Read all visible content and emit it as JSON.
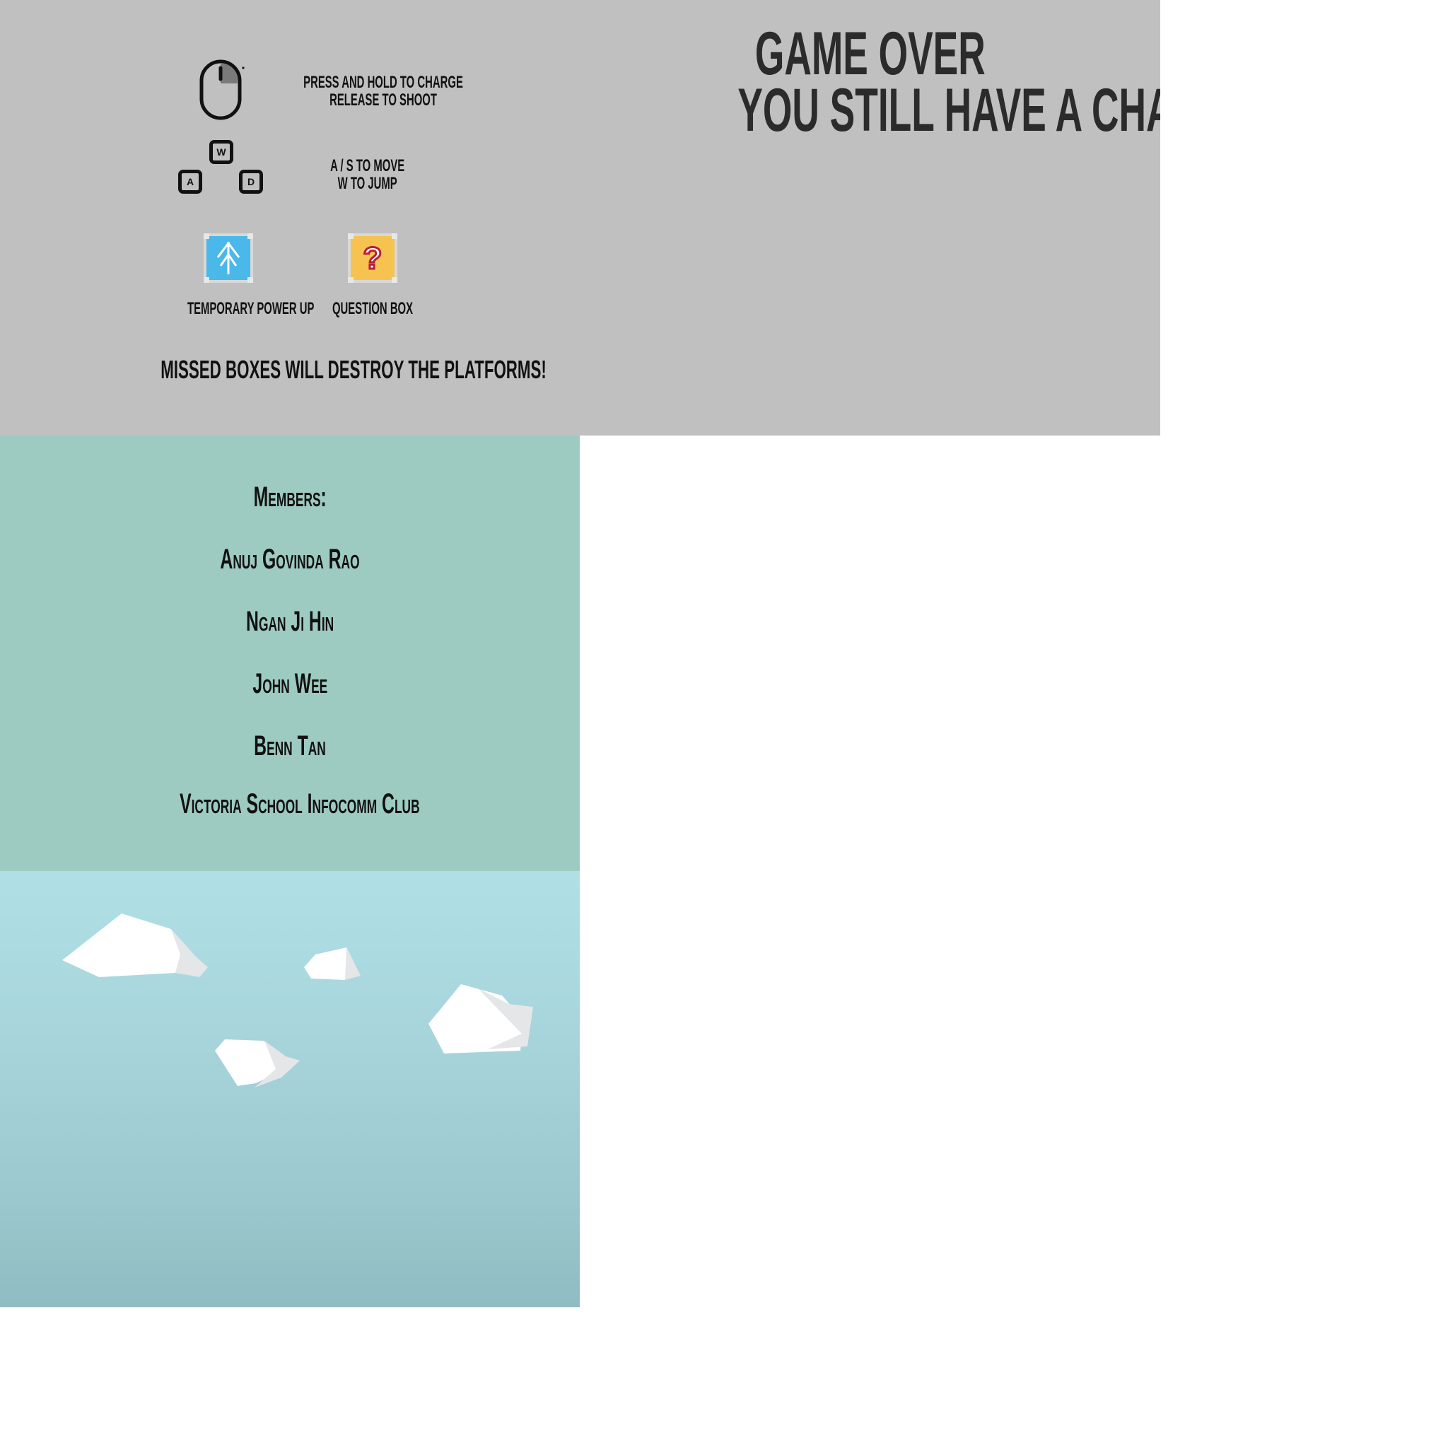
{
  "instructions": {
    "mouse_line1": "PRESS AND HOLD TO CHARGE",
    "mouse_line2": "RELEASE TO SHOOT",
    "keys": {
      "w": "W",
      "a": "A",
      "d": "D"
    },
    "move_line1": "A / S TO MOVE",
    "move_line2": "W TO JUMP",
    "powerup_label": "TEMPORARY POWER UP",
    "question_label": "QUESTION BOX",
    "question_symbol": "?",
    "warning": "MISSED BOXES WILL DESTROY THE PLATFORMS!"
  },
  "game_over": {
    "title": "GAME OVER",
    "subtitle": "YOU STILL HAVE A CHANCE"
  },
  "credits": {
    "heading": "Members:",
    "members": [
      "Anuj Govinda Rao",
      "Ngan Ji Hin",
      "John Wee",
      "Benn Tan"
    ],
    "club": "Victoria School Infocomm  Club"
  },
  "colors": {
    "instructions_bg": "#c0c0c0",
    "credits_bg": "#9ecbc1",
    "sky_top": "#b0e0e6",
    "sky_bottom": "#8ebcc1",
    "powerup_blue": "#4ab8e8",
    "question_yellow": "#f6c350",
    "question_mark": "#b81e3c"
  },
  "icons": [
    "mouse-icon",
    "keyboard-w-key",
    "keyboard-a-key",
    "keyboard-d-key",
    "powerup-arrow-icon",
    "question-box-icon",
    "cloud-icon"
  ]
}
